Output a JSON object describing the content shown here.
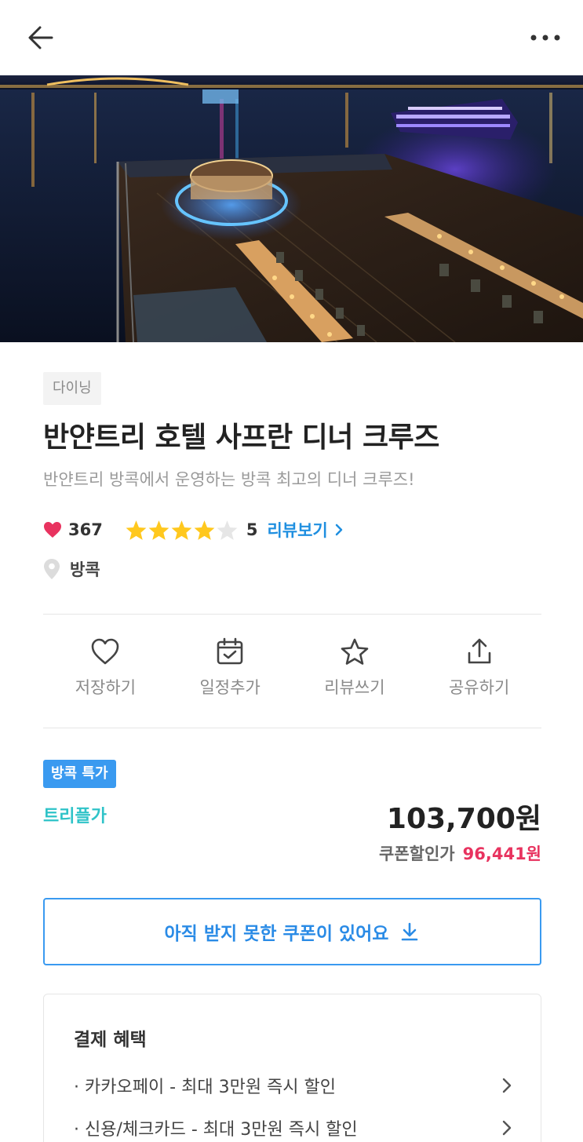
{
  "header": {
    "back_icon": "arrow-left-icon",
    "more_icon": "more-horizontal-icon"
  },
  "product": {
    "category": "다이닝",
    "title": "반얀트리 호텔 사프란 디너 크루즈",
    "subtitle": "반얀트리 방콕에서 운영하는 방콕 최고의 디너 크루즈!",
    "like_count": "367",
    "rating": "5",
    "rating_stars": 4,
    "review_link": "리뷰보기",
    "location": "방콕"
  },
  "actions": [
    {
      "label": "저장하기",
      "icon": "heart-outline-icon"
    },
    {
      "label": "일정추가",
      "icon": "calendar-check-icon"
    },
    {
      "label": "리뷰쓰기",
      "icon": "star-outline-icon"
    },
    {
      "label": "공유하기",
      "icon": "share-icon"
    }
  ],
  "pricing": {
    "promo_badge": "방콕 특가",
    "price_label": "트리플가",
    "price": "103,700원",
    "coupon_price_label": "쿠폰할인가",
    "coupon_price": "96,441원"
  },
  "coupon_button": {
    "label": "아직 받지 못한 쿠폰이 있어요"
  },
  "benefits": {
    "title": "결제 혜택",
    "items": [
      {
        "label": "· 카카오페이 - 최대 3만원 즉시 할인"
      },
      {
        "label": "· 신용/체크카드 - 최대 3만원 즉시 할인"
      }
    ]
  },
  "colors": {
    "accent_blue": "#3a9af0",
    "teal": "#2fc3c8",
    "discount_red": "#e8335f",
    "heart_red": "#e8335f",
    "star_yellow": "#ffc81e"
  }
}
